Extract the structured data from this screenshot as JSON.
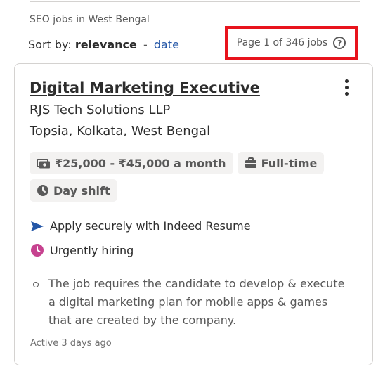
{
  "search": {
    "title": "SEO jobs in West Bengal"
  },
  "sort": {
    "prefix": "Sort by:",
    "current": "relevance",
    "separator": "-",
    "alternate": "date"
  },
  "pagination": {
    "text": "Page 1 of 346 jobs",
    "help_icon": "question-circle-icon"
  },
  "job": {
    "title": "Digital Marketing Executive",
    "company": "RJS Tech Solutions LLP",
    "location": "Topsia, Kolkata, West Bengal",
    "salary": "₹25,000 - ₹45,000 a month",
    "job_type": "Full-time",
    "shift": "Day shift",
    "apply_text": "Apply securely with Indeed Resume",
    "urgent_text": "Urgently hiring",
    "snippet": "The job requires the candidate to develop & execute a digital marketing plan for mobile apps & games that are created by the company.",
    "posted": "Active 3 days ago"
  },
  "colors": {
    "link": "#2557a7",
    "highlight_border": "#e8131c",
    "urgent": "#c6428f",
    "text": "#2d2d2d",
    "muted": "#595959"
  }
}
